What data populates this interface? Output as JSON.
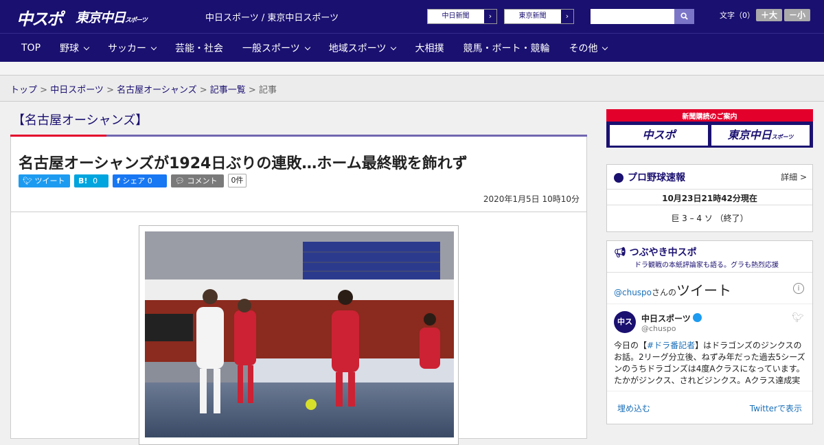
{
  "header": {
    "logo_chuspo": "中スポ",
    "logo_tokyo": "東京中日",
    "logo_tokyo_small": "スポーツ",
    "site_title": "中日スポーツ / 東京中日スポーツ",
    "np1": "中日新聞",
    "np2": "東京新聞",
    "font_label": "文字（0）",
    "font_plus": "＋大",
    "font_minus": "－小"
  },
  "nav": [
    "TOP",
    "野球",
    "サッカー",
    "芸能・社会",
    "一般スポーツ",
    "地域スポーツ",
    "大相撲",
    "競馬・ボート・競輪",
    "その他"
  ],
  "breadcrumb": {
    "b1": "トップ",
    "b2": "中日スポーツ",
    "b3": "名古屋オーシャンズ",
    "b4": "記事一覧",
    "b5": "記事",
    "sep": " > "
  },
  "article": {
    "section": "【名古屋オーシャンズ】",
    "title": "名古屋オーシャンズが1924日ぶりの連敗…ホーム最終戦を飾れず",
    "tweet": "ツイート",
    "hatena": "B!",
    "hatena_count": "0",
    "fb": "シェア",
    "fb_count": "0",
    "comment": "コメント",
    "comment_count": "0件",
    "date": "2020年1月5日 10時10分"
  },
  "sidebar": {
    "subscribe_title": "新聞購読のご案内",
    "sub1": "中スポ",
    "sub2": "東京中日",
    "sub2_small": "スポーツ",
    "baseball_title": "プロ野球速報",
    "baseball_detail": "詳細 >",
    "baseball_time": "10月23日21時42分現在",
    "baseball_score": "巨 3 – 4 ソ （終了）",
    "tsubu_title": "つぶやき中スポ",
    "tsubu_sub": "ドラ観戦の本紙評論家も語る。グラも熱烈応援",
    "tw_handle_prefix": "@chuspo",
    "tw_handle_suffix": "さんの",
    "tw_label": "ツイート",
    "tw_name": "中日スポーツ",
    "tw_user": "@chuspo",
    "tw_text_1": "今日の【",
    "tw_tag": "#ドラ番記者",
    "tw_text_2": "】はドラゴンズのジンクスのお話。2リーグ分立後、ねずみ年だった過去5シーズンのうちドラゴンズは4度Aクラスになっています。たかがジンクス、されどジンクス。Aクラス達成実",
    "tw_embed": "埋め込む",
    "tw_view": "Twitterで表示"
  },
  "colors": {
    "brand": "#1a1070",
    "accent": "#e3002b"
  }
}
